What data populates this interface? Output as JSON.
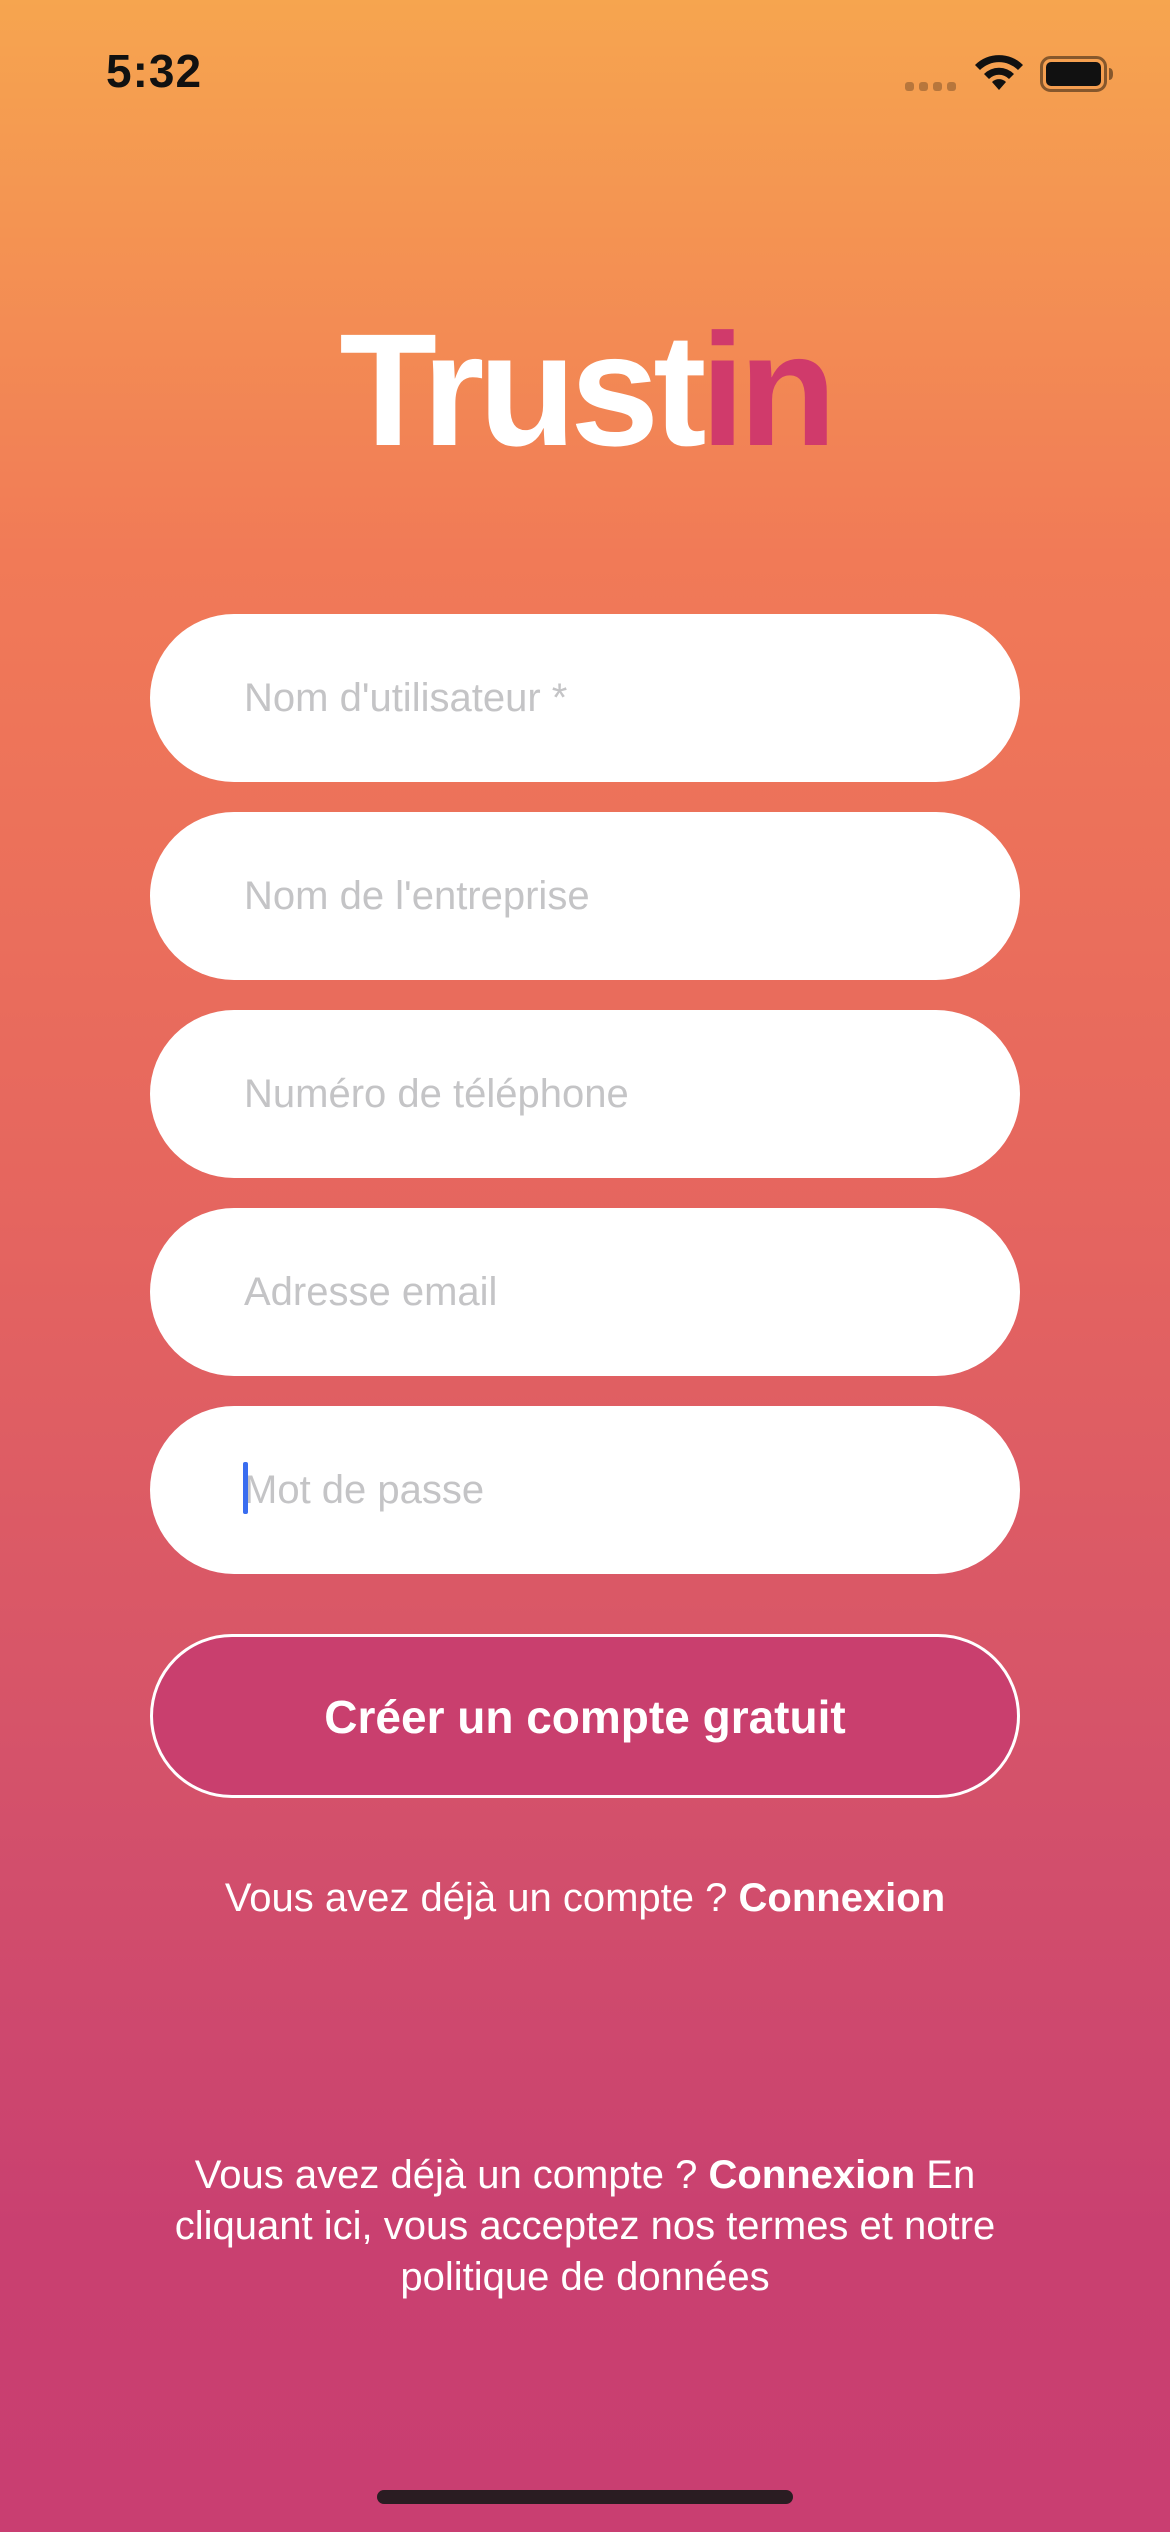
{
  "status_bar": {
    "time": "5:32",
    "icons": [
      "signal-icon",
      "wifi-icon",
      "battery-icon"
    ]
  },
  "logo": {
    "part1": "Trust",
    "part2": "in",
    "colors": {
      "part1": "#FFFFFF",
      "part2": "#D03A6B"
    }
  },
  "form": {
    "fields": [
      {
        "placeholder": "Nom d'utilisateur *",
        "value": ""
      },
      {
        "placeholder": "Nom de l'entreprise",
        "value": ""
      },
      {
        "placeholder": "Numéro de téléphone",
        "value": ""
      },
      {
        "placeholder": "Adresse email",
        "value": ""
      },
      {
        "placeholder": "Mot de passe",
        "value": ""
      }
    ],
    "submit_label": "Créer un compte gratuit"
  },
  "login_prompt": {
    "text": "Vous avez déjà un compte ?",
    "link": "Connexion"
  },
  "legal": {
    "text": "Vous avez déjà un compte ?",
    "link": "Connexion",
    "continuation": "En cliquant ici, vous acceptez nos termes et notre politique de données"
  },
  "colors": {
    "gradient_top": "#F6A54F",
    "gradient_bottom": "#C93E71",
    "button_bg": "#C93F6E",
    "caret": "#3A6DF0"
  }
}
